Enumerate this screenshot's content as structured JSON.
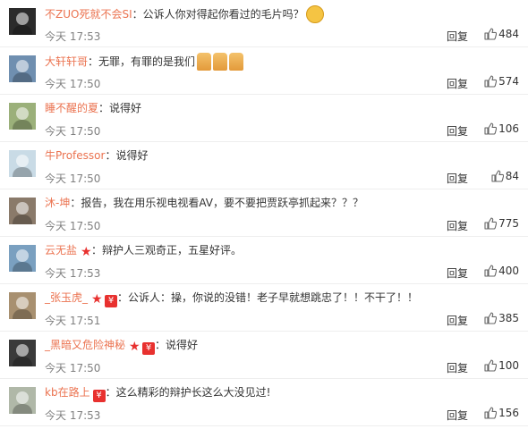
{
  "comments": [
    {
      "user": "不ZUO死就不会SI",
      "separator": "：",
      "text": "公诉人你对得起你看过的毛片吗？",
      "emojis": [
        "dog-emoji"
      ],
      "badges": [],
      "time": "今天 17:53",
      "reply": "回复",
      "likes": "484"
    },
    {
      "user": "大轩轩哥",
      "separator": "：",
      "text": "无罪，有罪的是我们",
      "emojis": [
        "pray-emoji",
        "pray-emoji",
        "pray-emoji"
      ],
      "badges": [],
      "time": "今天 17:50",
      "reply": "回复",
      "likes": "574"
    },
    {
      "user": "睡不醒的夏",
      "separator": "：",
      "text": "说得好",
      "emojis": [],
      "badges": [],
      "time": "今天 17:50",
      "reply": "回复",
      "likes": "106"
    },
    {
      "user": "牛Professor",
      "separator": "：",
      "text": "说得好",
      "emojis": [],
      "badges": [],
      "time": "今天 17:50",
      "reply": "回复",
      "likes": "84"
    },
    {
      "user": "沐-坤",
      "separator": "：",
      "text": "报告，我在用乐视电视看AV，要不要把贾跃亭抓起来？？？",
      "emojis": [],
      "badges": [],
      "time": "今天 17:50",
      "reply": "回复",
      "likes": "775"
    },
    {
      "user": "云无盐",
      "separator": "：",
      "text": "辩护人三观奇正，五星好评。",
      "emojis": [],
      "badges": [
        "star"
      ],
      "time": "今天 17:53",
      "reply": "回复",
      "likes": "400"
    },
    {
      "user": "_张玉虎_",
      "separator": "：",
      "text": "公诉人：操，你说的没错！老子早就想跳忠了！！不干了！！",
      "emojis": [],
      "badges": [
        "star",
        "red"
      ],
      "time": "今天 17:51",
      "reply": "回复",
      "likes": "385"
    },
    {
      "user": "_黑暗又危险神秘",
      "separator": "：",
      "text": "说得好",
      "emojis": [],
      "badges": [
        "star",
        "red"
      ],
      "time": "今天 17:50",
      "reply": "回复",
      "likes": "100"
    },
    {
      "user": "kb在路上",
      "separator": "：",
      "text": "这么精彩的辩护长这么大没见过!",
      "emojis": [],
      "badges": [
        "red"
      ],
      "time": "今天 17:53",
      "reply": "回复",
      "likes": "156"
    }
  ],
  "avatar_colors": [
    "#2b2b2b",
    "#6f8fb0",
    "#9bb07a",
    "#c9dbe6",
    "#8a7a6a",
    "#7aa0c0",
    "#a89070",
    "#3a3a3a",
    "#b0b8a8"
  ],
  "colors": {
    "username": "#eb7350",
    "time": "#808080",
    "badge": "#e8312f"
  }
}
